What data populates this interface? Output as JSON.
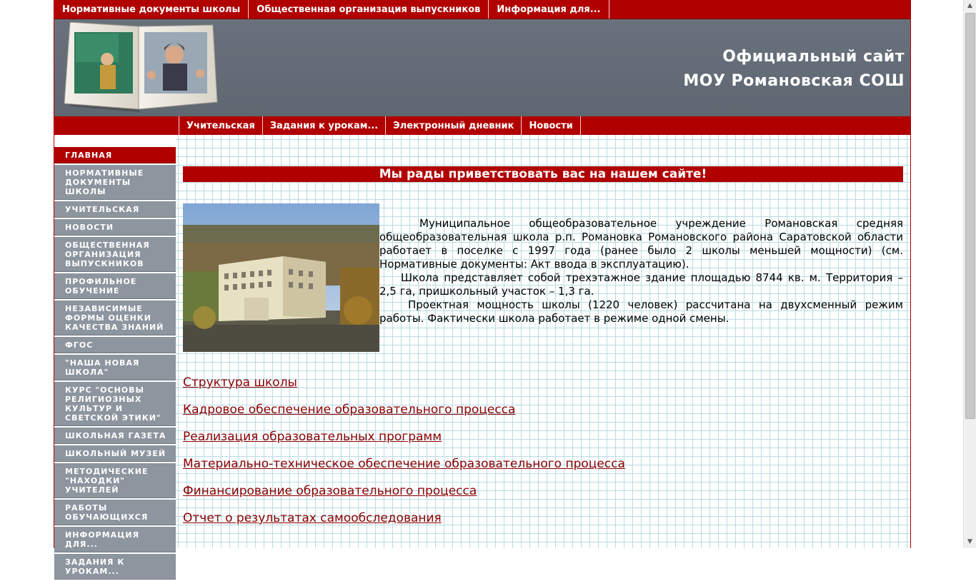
{
  "top_nav": [
    {
      "label": "Нормативные документы школы"
    },
    {
      "label": "Общественная организация выпускников"
    },
    {
      "label": "Информация для..."
    }
  ],
  "header": {
    "title_line1": "Официальный сайт",
    "title_line2": "МОУ Романовская СОШ"
  },
  "sub_nav": [
    {
      "label": "Учительская"
    },
    {
      "label": "Задания к урокам..."
    },
    {
      "label": "Электронный дневник"
    },
    {
      "label": "Новости"
    }
  ],
  "sidebar": {
    "items": [
      {
        "label": "Главная",
        "active": true
      },
      {
        "label": "Нормативные документы школы"
      },
      {
        "label": "Учительская"
      },
      {
        "label": "Новости"
      },
      {
        "label": "Общественная организация выпускников"
      },
      {
        "label": "Профильное обучение"
      },
      {
        "label": "Независимые формы оценки качества знаний"
      },
      {
        "label": "ФГОС"
      },
      {
        "label": "\"Наша новая школа\""
      },
      {
        "label": "Курс \"Основы религиозных культур и светской этики\""
      },
      {
        "label": "Школьная газета"
      },
      {
        "label": "Школьный музей"
      },
      {
        "label": "Методические \"находки\" учителей"
      },
      {
        "label": "Работы обучающихся"
      },
      {
        "label": "Информация для..."
      },
      {
        "label": "Задания к урокам..."
      }
    ]
  },
  "main": {
    "welcome": "Мы рады приветствовать вас на нашем сайте!",
    "paragraphs": [
      "Муниципальное общеобразовательное учреждение Романовская средняя общеобразовательная школа р.п. Романовка Романовского района Саратовской области работает в поселке с 1997 года (ранее было 2  школы меньшей мощности) (см. Нормативные документы: Акт ввода в эксплуатацию).",
      "Школа представляет собой трехэтажное здание площадью 8744 кв. м. Территория – 2,5 га, пришкольный участок – 1,3 га.",
      "Проектная мощность школы (1220 человек) рассчитана на двухсменный режим работы. Фактически школа работает в режиме одной смены."
    ],
    "links": [
      {
        "label": "Структура школы"
      },
      {
        "label": "Кадровое обеспечение образовательного процесса"
      },
      {
        "label": "Реализация образовательных программ"
      },
      {
        "label": "Материально-техническое обеспечение образовательного процесса"
      },
      {
        "label": "Финансирование образовательного процесса"
      },
      {
        "label": "Отчет о результатах самообследования"
      }
    ]
  },
  "colors": {
    "brand_red": "#b00000",
    "header_gray": "#646c77",
    "sidebar_gray": "#8d959f",
    "link_color": "#8b0000",
    "grid_line": "#b9dbe4"
  }
}
